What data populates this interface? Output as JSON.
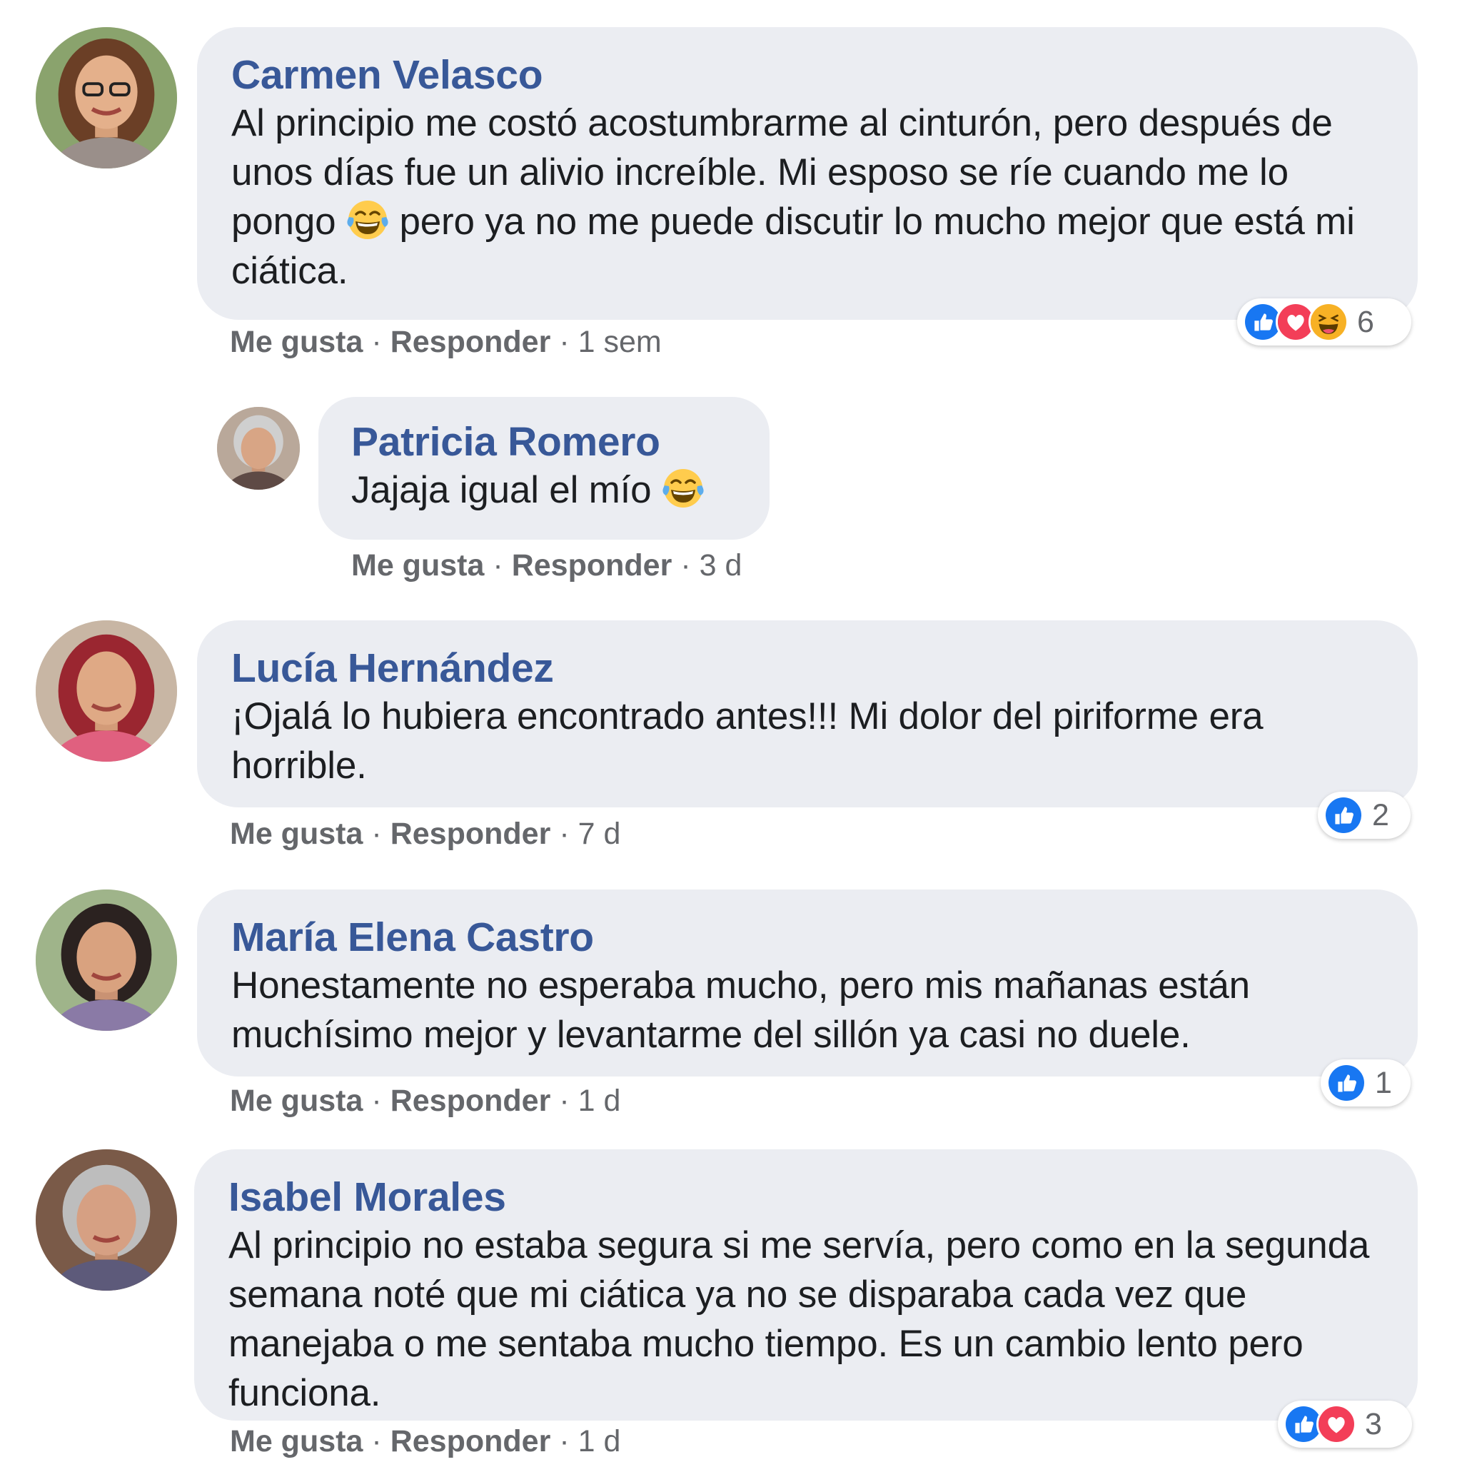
{
  "comments": [
    {
      "author": "Carmen Velasco",
      "text_before": "Al principio me costó acostumbrarme al cinturón, pero después de unos días fue un alivio increíble. Mi esposo se ríe cuando me lo pongo",
      "emoji": "joy-emoji",
      "text_after": "pero ya no me puede discutir lo mucho mejor que está mi ciática.",
      "like_label": "Me gusta",
      "reply_label": "Responder",
      "time": "1 sem",
      "reactions": [
        "like-icon",
        "love-icon",
        "haha-icon"
      ],
      "reaction_count": "6"
    },
    {
      "author": "Patricia Romero",
      "text_before": "Jajaja igual el mío",
      "emoji": "joy-emoji",
      "like_label": "Me gusta",
      "reply_label": "Responder",
      "time": "3 d",
      "is_reply": true
    },
    {
      "author": "Lucía Hernández",
      "text": "¡Ojalá lo hubiera encontrado antes!!! Mi dolor del piriforme era horrible.",
      "like_label": "Me gusta",
      "reply_label": "Responder",
      "time": "7 d",
      "reactions": [
        "like-icon"
      ],
      "reaction_count": "2"
    },
    {
      "author": "María Elena Castro",
      "text": "Honestamente no esperaba mucho, pero mis mañanas están muchísimo mejor y levantarme del sillón ya casi no duele.",
      "like_label": "Me gusta",
      "reply_label": "Responder",
      "time": "1 d",
      "reactions": [
        "like-icon"
      ],
      "reaction_count": "1"
    },
    {
      "author": "Isabel Morales",
      "text": "Al principio no estaba segura si me servía, pero como en la segunda semana noté que mi ciática ya no se disparaba cada vez que manejaba o me sentaba mucho tiempo. Es un cambio lento pero funciona.",
      "like_label": "Me gusta",
      "reply_label": "Responder",
      "time": "1 d",
      "reactions": [
        "like-icon",
        "love-icon"
      ],
      "reaction_count": "3"
    }
  ],
  "colors": {
    "name": "#385898",
    "bubble": "#ebedf2",
    "meta": "#65676b",
    "like": "#1877f2",
    "love": "#f33e58",
    "haha": "#f7b125"
  }
}
